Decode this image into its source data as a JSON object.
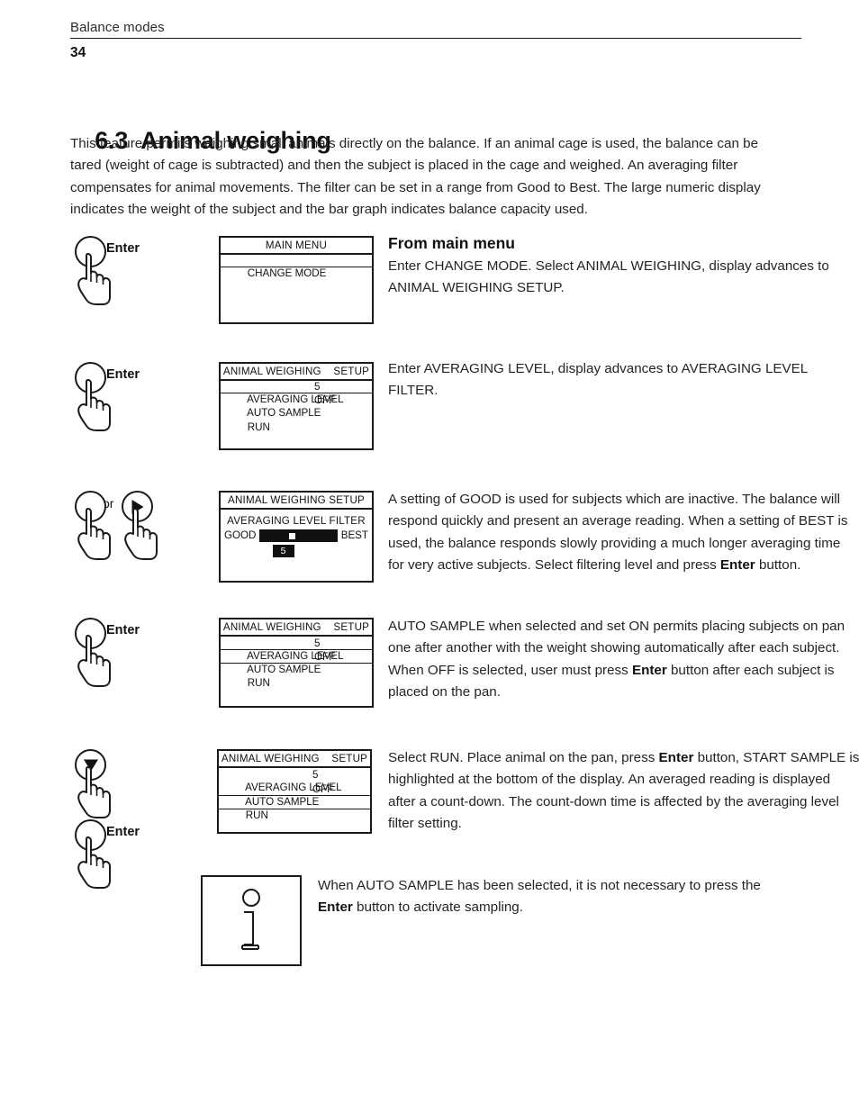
{
  "header": {
    "running_title": "Balance modes",
    "page_number": "34"
  },
  "section": {
    "number": "6.3",
    "title": "Animal weighing",
    "intro": "This feature permits weighing small animals directly on the balance. If an animal cage is used, the balance can be tared (weight of cage is subtracted) and then the subject is placed in the cage and weighed. An averaging filter compensates for animal movements. The filter can be set in a range from Good to Best. The large numeric display indicates the weight of the subject and the bar graph indicates balance capacity used."
  },
  "steps": {
    "step1": {
      "key_label": "Enter",
      "display": {
        "title": "MAIN MENU",
        "rows": [
          {
            "label": "CHANGE MODE",
            "value": "",
            "selected": true
          }
        ]
      },
      "heading": "From main menu",
      "text": "Enter CHANGE MODE. Select ANIMAL WEIGHING, display advances to ANIMAL WEIGHING SETUP."
    },
    "step2": {
      "key_label": "Enter",
      "display": {
        "title": "ANIMAL WEIGHING    SETUP",
        "rows": [
          {
            "label": "AVERAGING LEVEL",
            "value": "5",
            "selected": true
          },
          {
            "label": "AUTO SAMPLE",
            "value": "OFF",
            "selected": false
          },
          {
            "label": "RUN",
            "value": "",
            "selected": false
          }
        ]
      },
      "text": "Enter AVERAGING LEVEL, display advances to AVERAGING LEVEL FILTER."
    },
    "step3": {
      "or_label": "or",
      "arrow_icon": "arrow-right-icon",
      "display": {
        "title": "ANIMAL WEIGHING SETUP",
        "subtitle": "AVERAGING LEVEL FILTER",
        "slider": {
          "left_label": "GOOD",
          "right_label": "BEST",
          "value": "5",
          "marker_percent": 38
        }
      },
      "text_part1": "A setting of GOOD is used for subjects which are inactive. The balance will respond quickly and present an average reading. When a setting of BEST is used, the balance responds slowly providing a much longer averaging time for very active subjects. Select filtering level and press ",
      "text_bold": "Enter",
      "text_part2": " button."
    },
    "step4": {
      "key_label": "Enter",
      "display": {
        "title": "ANIMAL WEIGHING    SETUP",
        "rows": [
          {
            "label": "AVERAGING LEVEL",
            "value": "5",
            "selected": false
          },
          {
            "label": "AUTO SAMPLE",
            "value": "OFF",
            "selected": true
          },
          {
            "label": "RUN",
            "value": "",
            "selected": false
          }
        ]
      },
      "text_part1": "AUTO SAMPLE when selected and set ON permits placing subjects on pan one after another with the weight showing automatically after each subject. When OFF is selected, user must press ",
      "text_bold": "Enter",
      "text_part2": " button after each subject is placed on the pan."
    },
    "step5": {
      "arrow_icon": "arrow-down-icon",
      "key_label": "Enter",
      "display": {
        "title": "ANIMAL WEIGHING    SETUP",
        "rows": [
          {
            "label": "AVERAGING LEVEL",
            "value": "5",
            "selected": false
          },
          {
            "label": "AUTO SAMPLE",
            "value": "OFF",
            "selected": false
          },
          {
            "label": "RUN",
            "value": "",
            "selected": true
          }
        ]
      },
      "text_part1": "Select RUN.  Place animal on the pan, press ",
      "text_bold": "Enter",
      "text_part2": " button, START SAMPLE is highlighted at the bottom of the display. An averaged reading is displayed after a count-down. The count-down time is affected by the averaging level filter setting."
    }
  },
  "note": {
    "icon": "info-icon",
    "text_part1": "When AUTO SAMPLE has been selected, it is not necessary to press the ",
    "text_bold": "Enter",
    "text_part2": " button to activate sampling."
  }
}
